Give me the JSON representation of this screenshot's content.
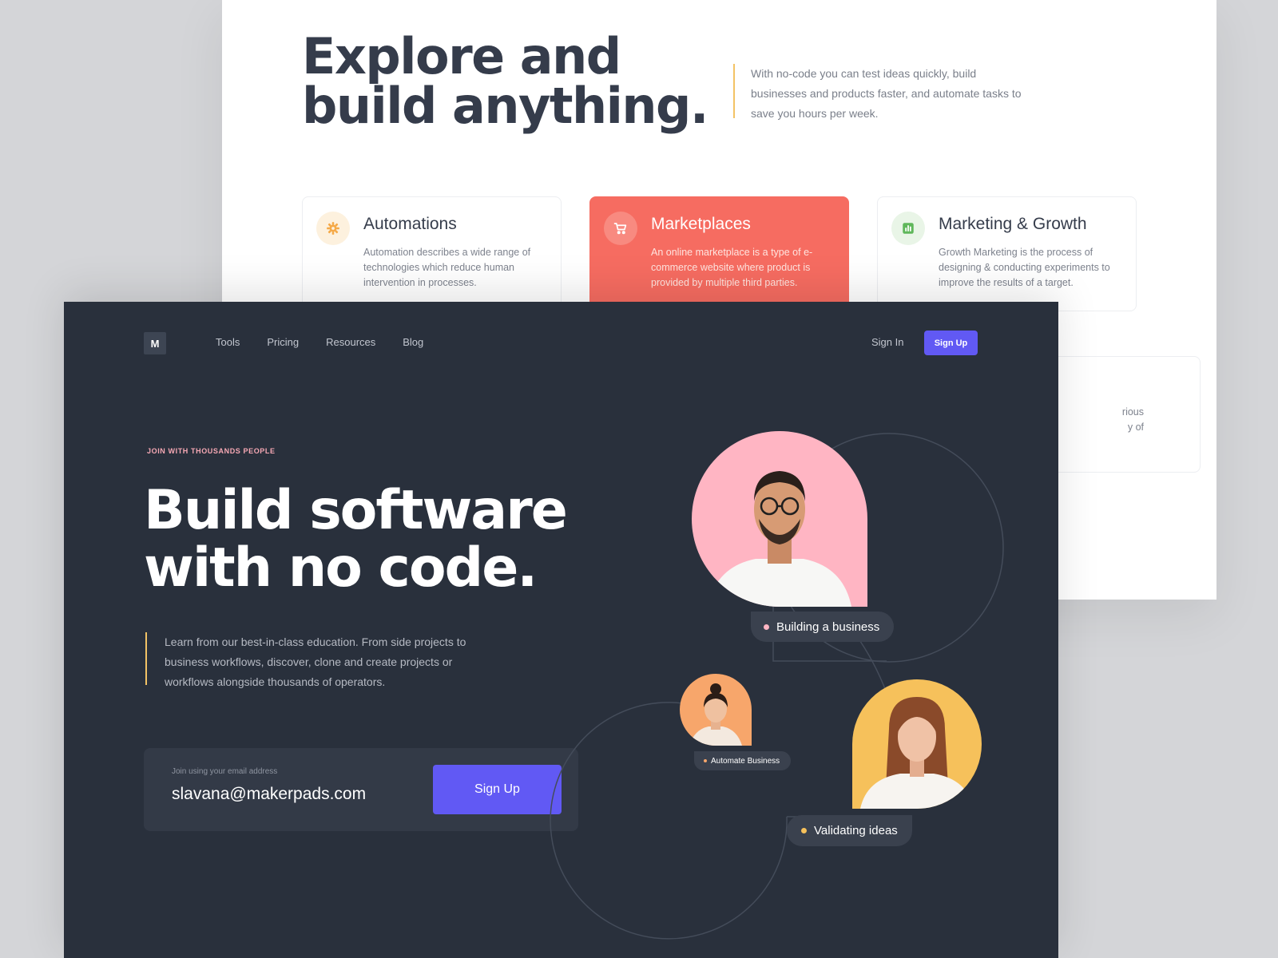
{
  "back_page": {
    "title_lines": [
      "Explore and",
      "build anything."
    ],
    "intro": "With no-code you can test ideas quickly, build businesses and products faster, and automate tasks to save you hours per week.",
    "cards": [
      {
        "title": "Automations",
        "description": "Automation describes a wide range of technologies which reduce human intervention in processes.",
        "icon": "gear-icon",
        "icon_color": "#f5a947"
      },
      {
        "title": "Marketplaces",
        "description": "An online marketplace is a type of e-commerce website where product is provided by multiple third parties.",
        "icon": "cart-icon",
        "icon_color": "#ffffff"
      },
      {
        "title": "Marketing & Growth",
        "description": "Growth Marketing is the process of designing & conducting experiments to improve the results of a target.",
        "icon": "bar-chart-icon",
        "icon_color": "#5fb75a"
      }
    ],
    "partial_card_text": [
      "rious",
      "y of"
    ]
  },
  "front_page": {
    "logo": "M",
    "nav": [
      "Tools",
      "Pricing",
      "Resources",
      "Blog"
    ],
    "sign_in": "Sign In",
    "sign_up": "Sign Up",
    "eyebrow": "JOIN WITH THOUSANDS PEOPLE",
    "hero_title_lines": [
      "Build software",
      "with no code."
    ],
    "hero_desc": "Learn from our best-in-class education. From side projects to business workflows, discover, clone and create projects or workflows alongside thousands of operators.",
    "email_label": "Join using your email address",
    "email_value": "slavana@makerpads.com",
    "email_button": "Sign Up",
    "chips": [
      "Building a business",
      "Automate Business",
      "Validating ideas"
    ]
  },
  "colors": {
    "accent": "#6159f4",
    "coral": "#f66c61",
    "yellow": "#f3c365",
    "pink": "#ffb5c3",
    "orange": "#f7a66b",
    "dark_bg": "#29303c"
  }
}
